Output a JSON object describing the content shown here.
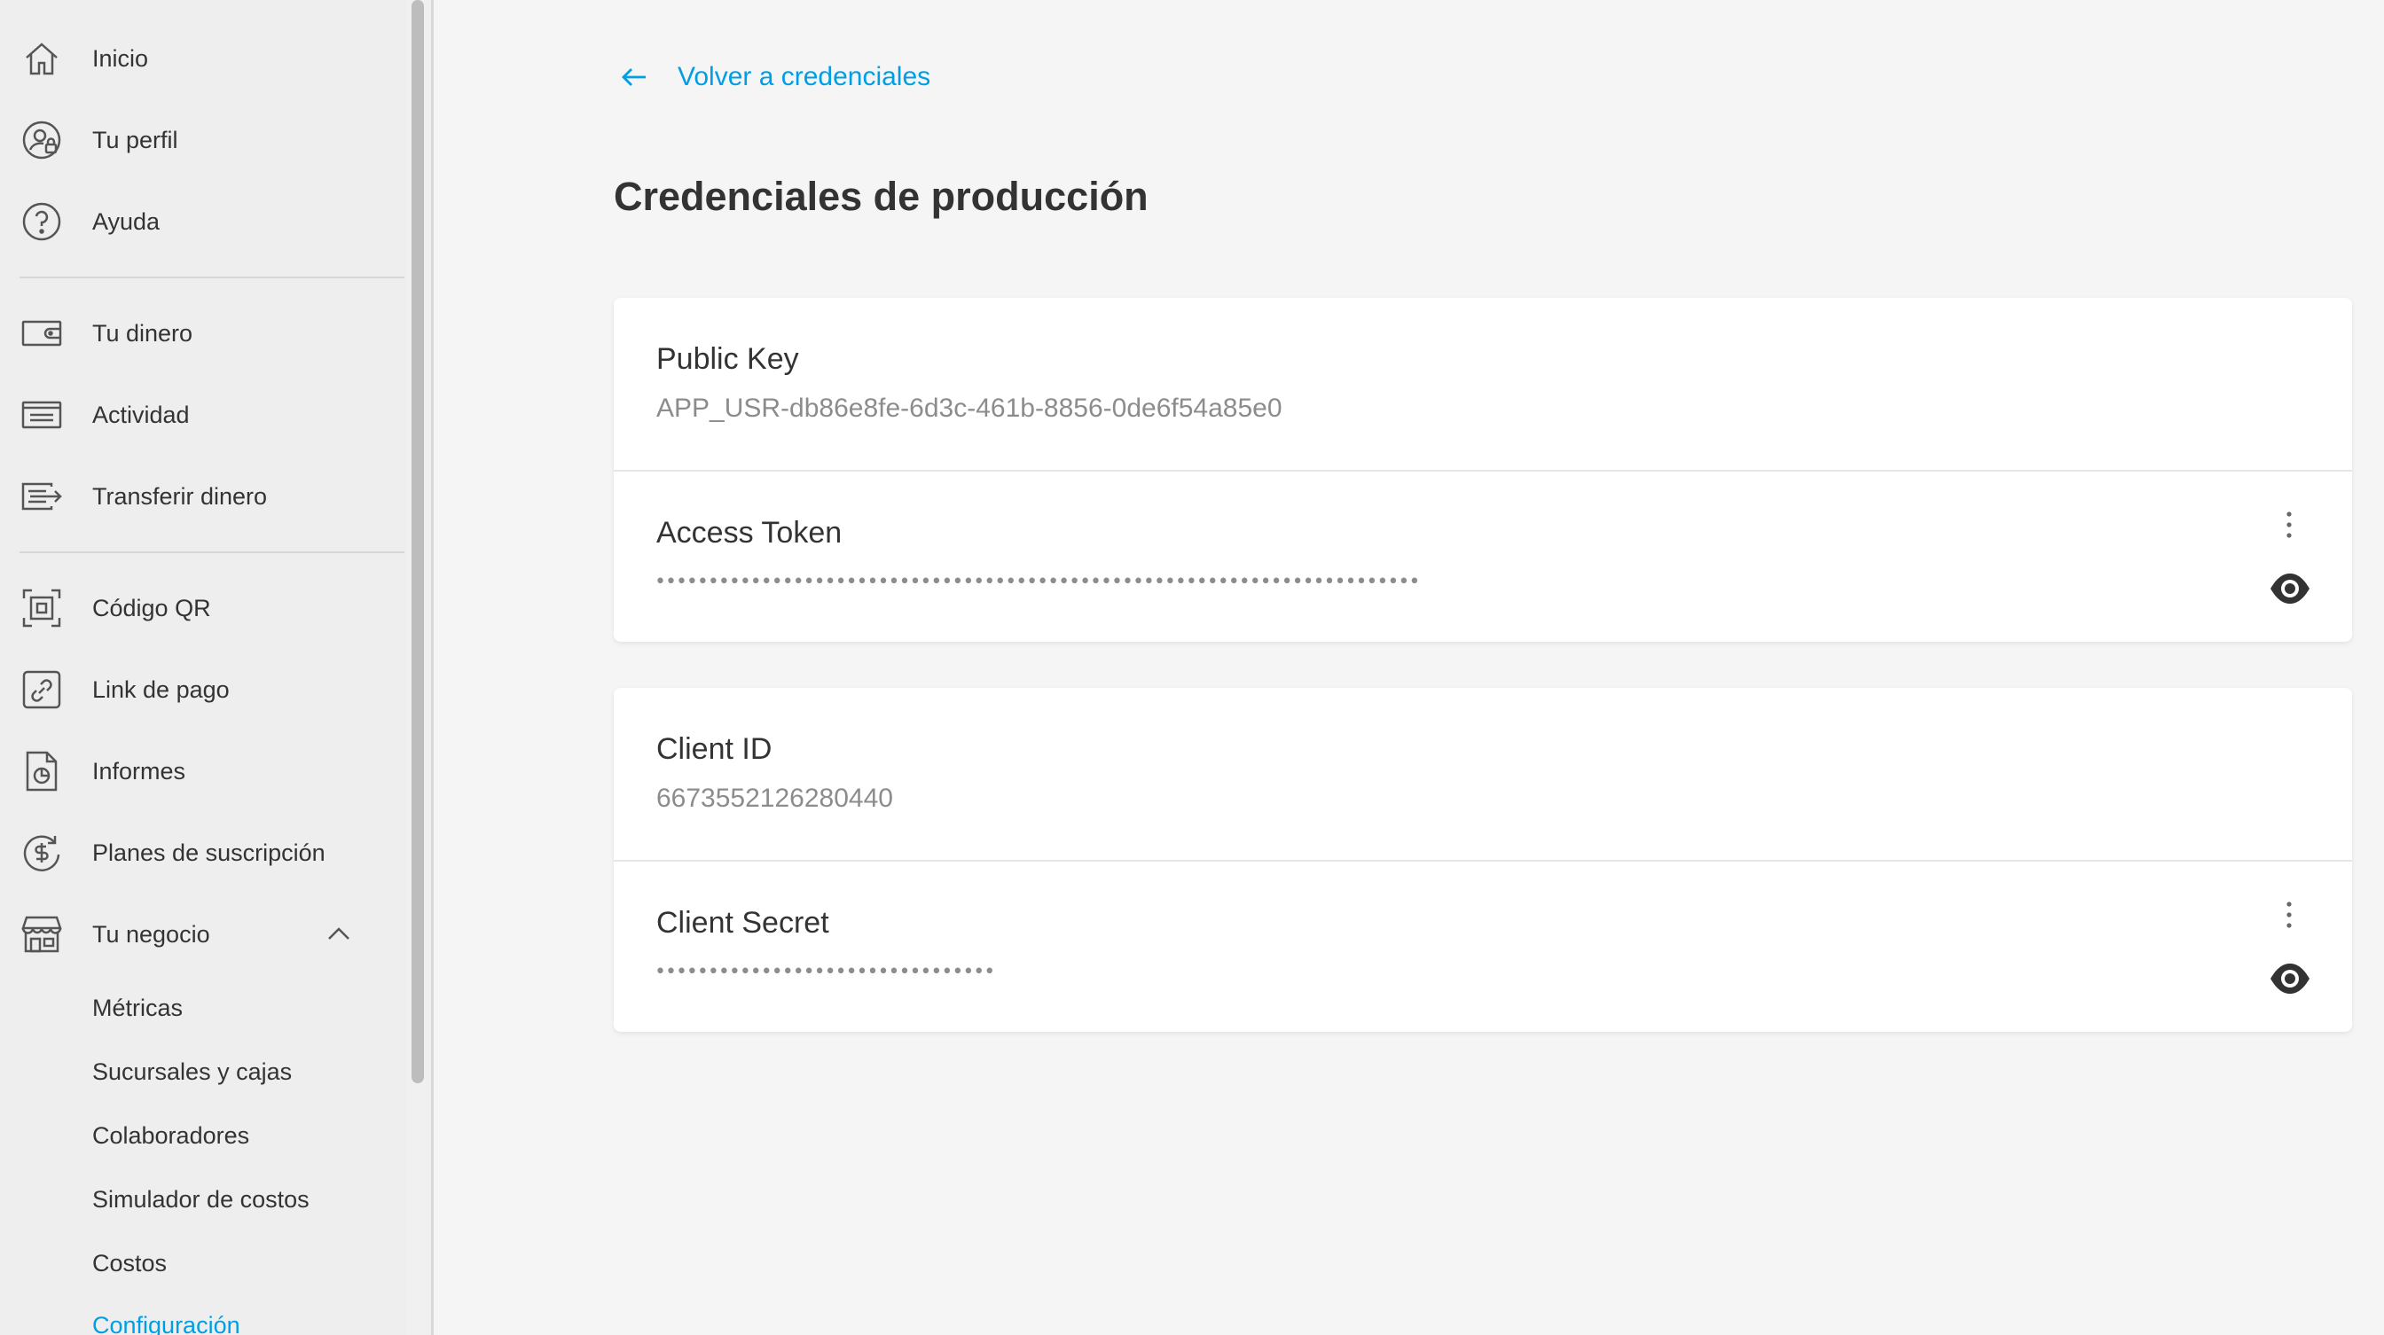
{
  "sidebar": {
    "items": [
      {
        "label": "Inicio",
        "icon": "home-icon"
      },
      {
        "label": "Tu perfil",
        "icon": "profile-lock-icon"
      },
      {
        "label": "Ayuda",
        "icon": "help-icon"
      },
      {
        "label": "Tu dinero",
        "icon": "wallet-icon"
      },
      {
        "label": "Actividad",
        "icon": "activity-icon"
      },
      {
        "label": "Transferir dinero",
        "icon": "transfer-icon"
      },
      {
        "label": "Código QR",
        "icon": "qr-icon"
      },
      {
        "label": "Link de pago",
        "icon": "link-icon"
      },
      {
        "label": "Informes",
        "icon": "report-icon"
      },
      {
        "label": "Planes de suscripción",
        "icon": "subscription-icon"
      },
      {
        "label": "Tu negocio",
        "icon": "store-icon"
      }
    ],
    "business_subitems": [
      "Métricas",
      "Sucursales y cajas",
      "Colaboradores",
      "Simulador de costos",
      "Costos",
      "Configuración"
    ]
  },
  "main": {
    "back_label": "Volver a credenciales",
    "title": "Credenciales de producción",
    "card1": {
      "public_key_label": "Public Key",
      "public_key_value": "APP_USR-db86e8fe-6d3c-461b-8856-0de6f54a85e0",
      "access_token_label": "Access Token",
      "access_token_mask": "••••••••••••••••••••••••••••••••••••••••••••••••••••••••••••••••••••••••"
    },
    "card2": {
      "client_id_label": "Client ID",
      "client_id_value": "6673552126280440",
      "client_secret_label": "Client Secret",
      "client_secret_mask": "••••••••••••••••••••••••••••••••"
    }
  },
  "colors": {
    "accent": "#009ee3",
    "sidebar_bg": "#eeeeee",
    "page_bg": "#f5f5f6"
  }
}
